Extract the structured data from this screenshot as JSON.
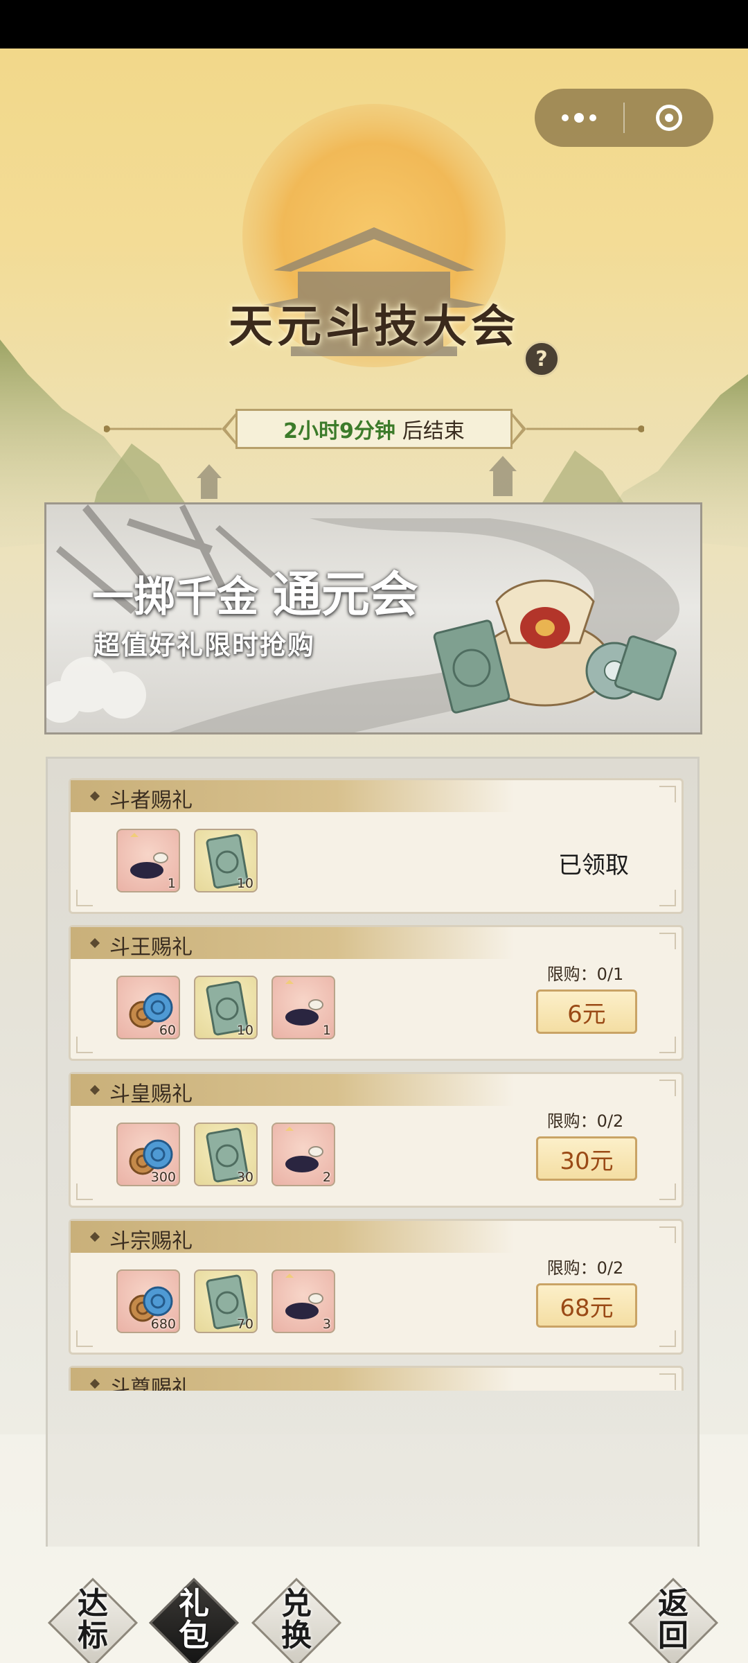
{
  "event": {
    "title": "天元斗技大会",
    "help_label": "?",
    "timer_remaining": "2小时9分钟",
    "timer_suffix": "后结束"
  },
  "banner": {
    "title_part1": "一掷千金",
    "title_part2": "通元会",
    "subtitle": "超值好礼限时抢购"
  },
  "gifts": [
    {
      "name": "斗者赐礼",
      "items": [
        {
          "icon": "ink-stone-icon",
          "count": "1"
        },
        {
          "icon": "jade-token-icon",
          "count": "10"
        }
      ],
      "status": "已领取"
    },
    {
      "name": "斗王赐礼",
      "limit": "限购：0/1",
      "price": "6元",
      "items": [
        {
          "icon": "cloud-swirl-icon",
          "count": "60"
        },
        {
          "icon": "jade-token-icon",
          "count": "10"
        },
        {
          "icon": "ink-stone-icon",
          "count": "1"
        }
      ]
    },
    {
      "name": "斗皇赐礼",
      "limit": "限购：0/2",
      "price": "30元",
      "items": [
        {
          "icon": "cloud-swirl-icon",
          "count": "300"
        },
        {
          "icon": "jade-token-icon",
          "count": "30"
        },
        {
          "icon": "ink-stone-icon",
          "count": "2"
        }
      ]
    },
    {
      "name": "斗宗赐礼",
      "limit": "限购：0/2",
      "price": "68元",
      "items": [
        {
          "icon": "cloud-swirl-icon",
          "count": "680"
        },
        {
          "icon": "jade-token-icon",
          "count": "70"
        },
        {
          "icon": "ink-stone-icon",
          "count": "3"
        }
      ]
    },
    {
      "name": "斗尊赐礼"
    }
  ],
  "tabs": {
    "achieve": "达\n标",
    "gift": "礼\n包",
    "exchange": "兑\n换",
    "back": "返\n回"
  },
  "colors": {
    "accent_gold": "#c9b07a",
    "price_text": "#9a4a16",
    "timer_green": "#3c7b2a"
  }
}
